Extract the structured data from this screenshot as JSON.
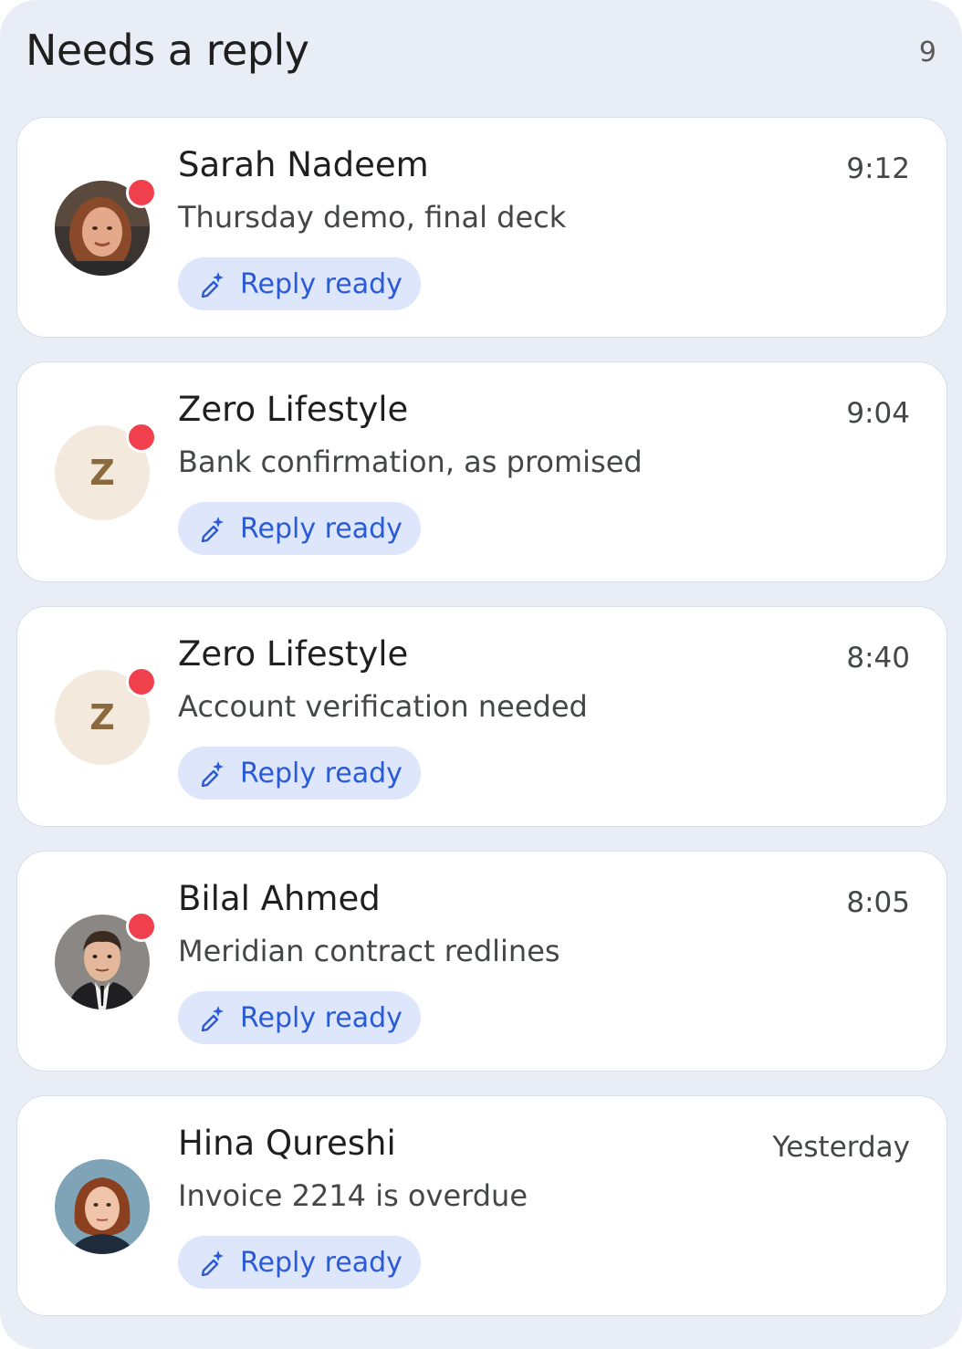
{
  "header": {
    "title": "Needs a reply",
    "count": "9"
  },
  "messages": [
    {
      "sender": "Sarah Nadeem",
      "time": "9:12",
      "subject": "Thursday demo, final deck",
      "reply_label": "Reply ready",
      "avatar": "photo-woman-1",
      "unread": true
    },
    {
      "sender": "Zero Lifestyle",
      "time": "9:04",
      "subject": "Bank confirmation, as promised",
      "reply_label": "Reply ready",
      "avatar_letter": "Z",
      "unread": true
    },
    {
      "sender": "Zero Lifestyle",
      "time": "8:40",
      "subject": "Account verification needed",
      "reply_label": "Reply ready",
      "avatar_letter": "Z",
      "unread": true
    },
    {
      "sender": "Bilal Ahmed",
      "time": "8:05",
      "subject": "Meridian contract redlines",
      "reply_label": "Reply ready",
      "avatar": "photo-man-1",
      "unread": true
    },
    {
      "sender": "Hina Qureshi",
      "time": "Yesterday",
      "subject": "Invoice 2214 is overdue",
      "reply_label": "Reply ready",
      "avatar": "photo-woman-2",
      "unread": false
    }
  ],
  "colors": {
    "accent": "#2a5bd7",
    "chip_bg": "#dde6fb",
    "unread_dot": "#f0404d",
    "panel_bg": "#e9eef6"
  },
  "icons": {
    "reply_chip": "sparkle-pen-icon"
  }
}
